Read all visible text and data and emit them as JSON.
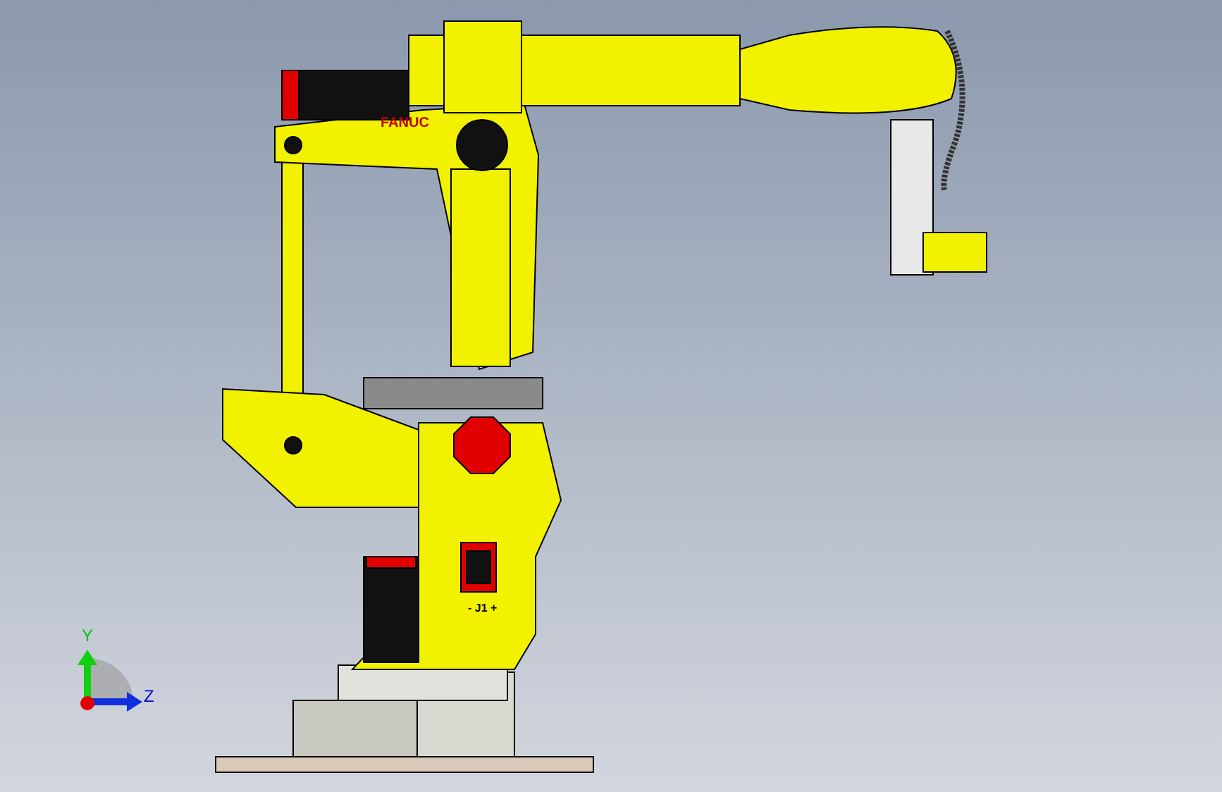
{
  "viewport": {
    "model_labels": [
      {
        "kind": "logo",
        "text": "FANUC"
      },
      {
        "kind": "joint",
        "text": "- J1 +"
      }
    ],
    "triad": {
      "axes": [
        {
          "kind": "y",
          "label": "Y"
        },
        {
          "kind": "z",
          "label": "Z"
        }
      ]
    }
  }
}
